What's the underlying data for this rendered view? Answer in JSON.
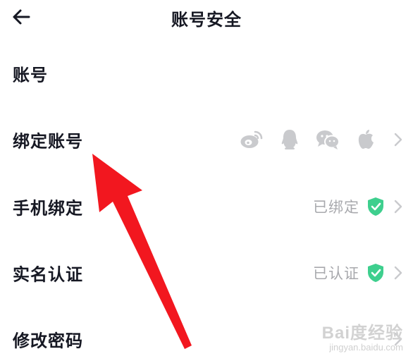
{
  "header": {
    "title": "账号安全",
    "back_icon": "arrow-left-icon"
  },
  "rows": [
    {
      "label": "账号"
    },
    {
      "label": "绑定账号",
      "social_icons": [
        "weibo-icon",
        "qq-icon",
        "wechat-icon",
        "apple-icon"
      ]
    },
    {
      "label": "手机绑定",
      "status": "已绑定",
      "status_icon": "verified-shield-icon"
    },
    {
      "label": "实名认证",
      "status": "已认证",
      "status_icon": "verified-shield-icon"
    },
    {
      "label": "修改密码"
    }
  ],
  "watermark": {
    "main": "Bai度经验",
    "sub": "jingyan.baidu.com"
  },
  "colors": {
    "text": "#161823",
    "muted": "#a8a9ad",
    "icon_gray": "#c9cacd",
    "shield_green": "#3ecf8e",
    "annotation_arrow": "#f2171f"
  }
}
